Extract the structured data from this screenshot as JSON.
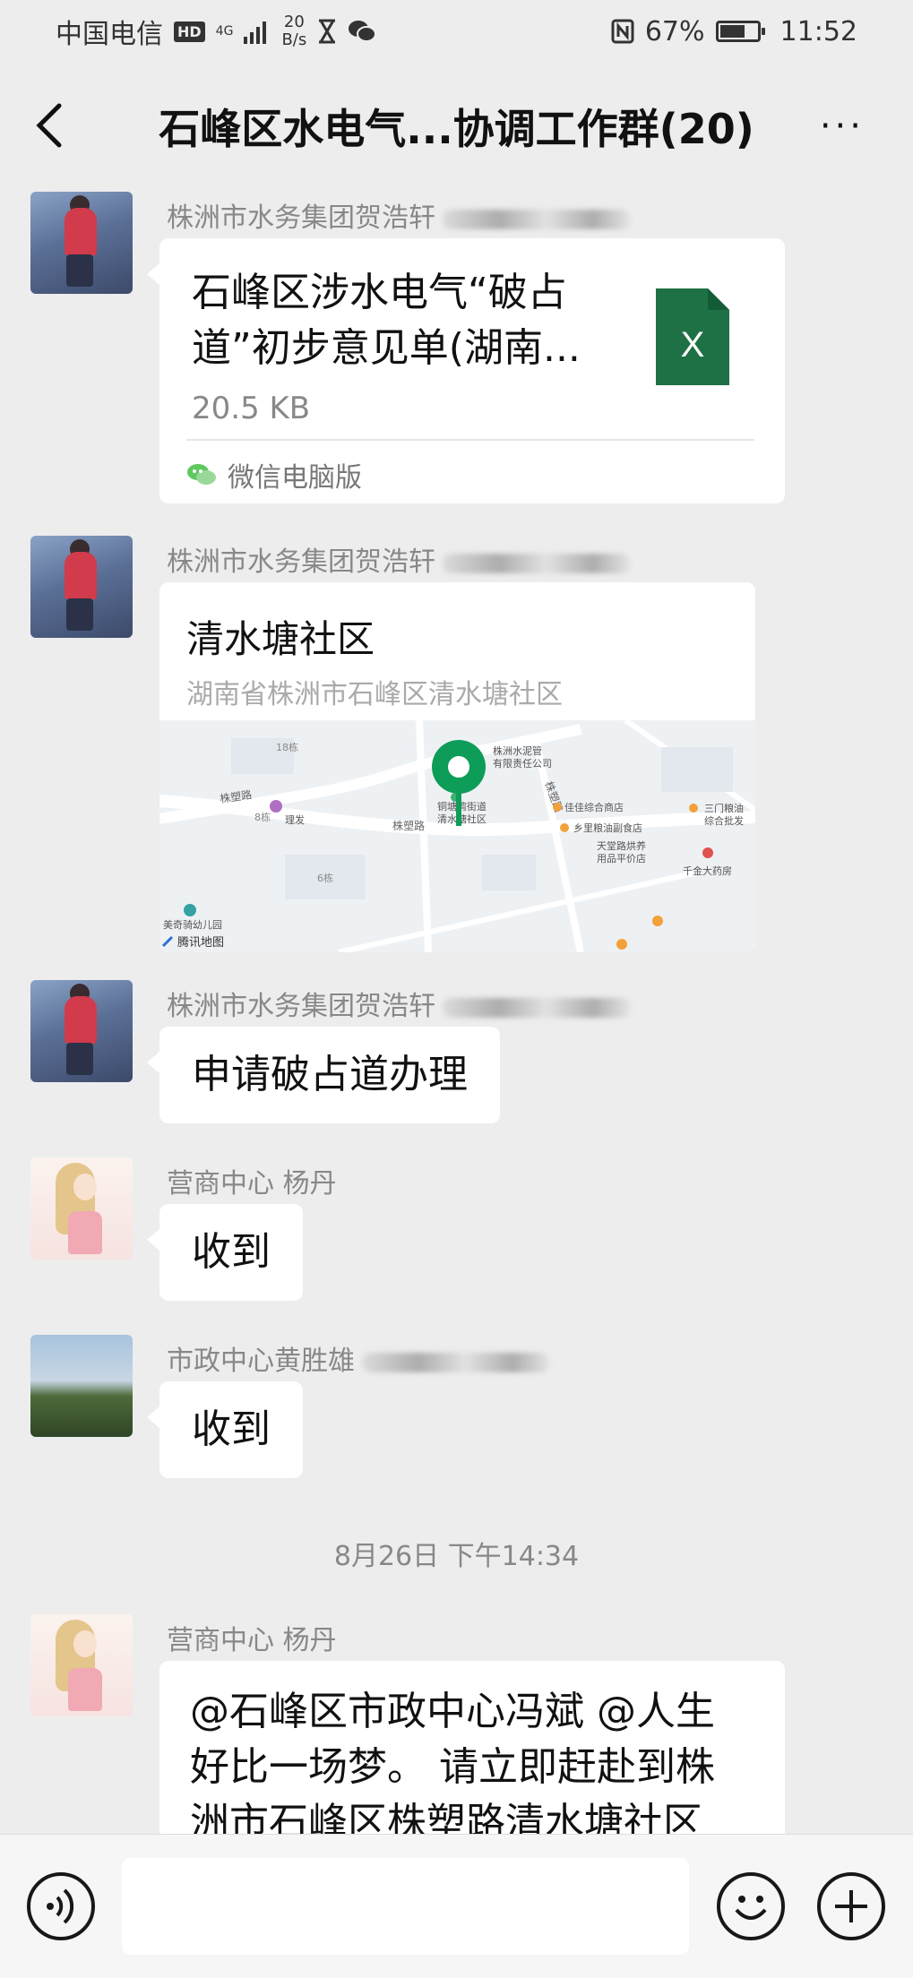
{
  "status_bar": {
    "carrier": "中国电信",
    "hd": "HD",
    "network": "4G",
    "speed_value": "20",
    "speed_unit": "B/s",
    "battery": "67%",
    "time": "11:52"
  },
  "header": {
    "title": "石峰区水电气...协调工作群(20)",
    "more": "···"
  },
  "messages": [
    {
      "sender": "株洲市水务集团贺浩轩",
      "file": {
        "name": "石峰区涉水电气“破占道”初步意见单(湖南...",
        "size": "20.5 KB",
        "icon_letter": "X",
        "source": "微信电脑版"
      }
    },
    {
      "sender": "株洲市水务集团贺浩轩",
      "location": {
        "title": "清水塘社区",
        "address": "湖南省株洲市石峰区清水塘社区",
        "map_labels": {
          "company": "株洲水泥管",
          "company2": "有限责任公司",
          "poi_community": "铜塘湾街道",
          "poi_community2": "清水塘社区",
          "store1": "佳佳综合商店",
          "store2": "乡里粮油副食店",
          "store3": "天堂路烘养",
          "store3b": "用品平价店",
          "store4": "三门粮油",
          "store4b": "综合批发",
          "pharmacy": "千金大药房",
          "kindergarten": "美奇骑幼儿园",
          "road1": "株塑路",
          "road2": "株塑路",
          "road3": "株塑路",
          "building1": "18栋",
          "building2": "8栋",
          "building3": "6栋",
          "salon": "理发",
          "provider": "腾讯地图"
        }
      }
    },
    {
      "sender": "株洲市水务集团贺浩轩",
      "text": "申请破占道办理"
    },
    {
      "sender": "营商中心 杨丹",
      "text": "收到"
    },
    {
      "sender": "市政中心黄胜雄",
      "text": "收到"
    }
  ],
  "timestamp": "8月26日 下午14:34",
  "last_message": {
    "sender": "营商中心 杨丹",
    "lines": [
      "@石峰区市政中心冯斌 @人生",
      "好比一场梦。 请立即赶赴到株",
      "洲市石峰区株塑路清水塘社区"
    ]
  }
}
